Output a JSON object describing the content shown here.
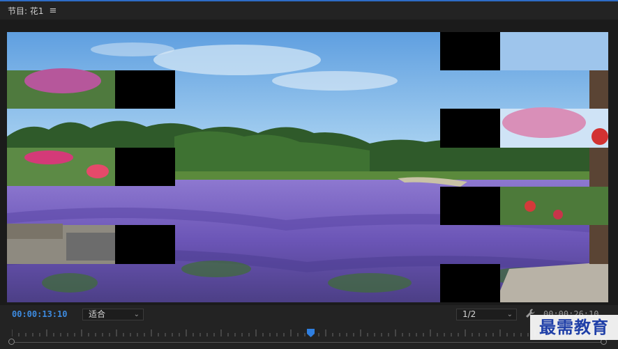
{
  "panel": {
    "title": "节目: 花1",
    "menu_icon": "hamburger-icon"
  },
  "timecode": {
    "current": "00:00:13:10",
    "duration": "00:00:26:10"
  },
  "fit_select": {
    "value": "适合"
  },
  "resolution_select": {
    "value": "1/2"
  },
  "playback": {
    "playhead_position": 0.505
  },
  "watermark": {
    "text": "最需教育"
  },
  "colors": {
    "accent": "#3d8be0",
    "panel_bg": "#232323",
    "watermark_text": "#1f3fa8"
  }
}
